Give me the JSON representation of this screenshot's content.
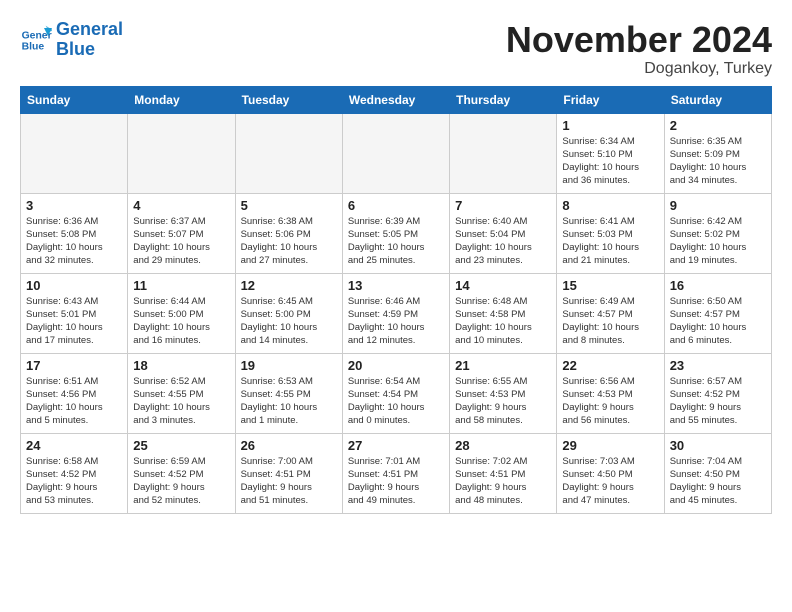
{
  "logo": {
    "line1": "General",
    "line2": "Blue"
  },
  "title": "November 2024",
  "location": "Dogankoy, Turkey",
  "columns": [
    "Sunday",
    "Monday",
    "Tuesday",
    "Wednesday",
    "Thursday",
    "Friday",
    "Saturday"
  ],
  "weeks": [
    [
      {
        "day": "",
        "info": ""
      },
      {
        "day": "",
        "info": ""
      },
      {
        "day": "",
        "info": ""
      },
      {
        "day": "",
        "info": ""
      },
      {
        "day": "",
        "info": ""
      },
      {
        "day": "1",
        "info": "Sunrise: 6:34 AM\nSunset: 5:10 PM\nDaylight: 10 hours\nand 36 minutes."
      },
      {
        "day": "2",
        "info": "Sunrise: 6:35 AM\nSunset: 5:09 PM\nDaylight: 10 hours\nand 34 minutes."
      }
    ],
    [
      {
        "day": "3",
        "info": "Sunrise: 6:36 AM\nSunset: 5:08 PM\nDaylight: 10 hours\nand 32 minutes."
      },
      {
        "day": "4",
        "info": "Sunrise: 6:37 AM\nSunset: 5:07 PM\nDaylight: 10 hours\nand 29 minutes."
      },
      {
        "day": "5",
        "info": "Sunrise: 6:38 AM\nSunset: 5:06 PM\nDaylight: 10 hours\nand 27 minutes."
      },
      {
        "day": "6",
        "info": "Sunrise: 6:39 AM\nSunset: 5:05 PM\nDaylight: 10 hours\nand 25 minutes."
      },
      {
        "day": "7",
        "info": "Sunrise: 6:40 AM\nSunset: 5:04 PM\nDaylight: 10 hours\nand 23 minutes."
      },
      {
        "day": "8",
        "info": "Sunrise: 6:41 AM\nSunset: 5:03 PM\nDaylight: 10 hours\nand 21 minutes."
      },
      {
        "day": "9",
        "info": "Sunrise: 6:42 AM\nSunset: 5:02 PM\nDaylight: 10 hours\nand 19 minutes."
      }
    ],
    [
      {
        "day": "10",
        "info": "Sunrise: 6:43 AM\nSunset: 5:01 PM\nDaylight: 10 hours\nand 17 minutes."
      },
      {
        "day": "11",
        "info": "Sunrise: 6:44 AM\nSunset: 5:00 PM\nDaylight: 10 hours\nand 16 minutes."
      },
      {
        "day": "12",
        "info": "Sunrise: 6:45 AM\nSunset: 5:00 PM\nDaylight: 10 hours\nand 14 minutes."
      },
      {
        "day": "13",
        "info": "Sunrise: 6:46 AM\nSunset: 4:59 PM\nDaylight: 10 hours\nand 12 minutes."
      },
      {
        "day": "14",
        "info": "Sunrise: 6:48 AM\nSunset: 4:58 PM\nDaylight: 10 hours\nand 10 minutes."
      },
      {
        "day": "15",
        "info": "Sunrise: 6:49 AM\nSunset: 4:57 PM\nDaylight: 10 hours\nand 8 minutes."
      },
      {
        "day": "16",
        "info": "Sunrise: 6:50 AM\nSunset: 4:57 PM\nDaylight: 10 hours\nand 6 minutes."
      }
    ],
    [
      {
        "day": "17",
        "info": "Sunrise: 6:51 AM\nSunset: 4:56 PM\nDaylight: 10 hours\nand 5 minutes."
      },
      {
        "day": "18",
        "info": "Sunrise: 6:52 AM\nSunset: 4:55 PM\nDaylight: 10 hours\nand 3 minutes."
      },
      {
        "day": "19",
        "info": "Sunrise: 6:53 AM\nSunset: 4:55 PM\nDaylight: 10 hours\nand 1 minute."
      },
      {
        "day": "20",
        "info": "Sunrise: 6:54 AM\nSunset: 4:54 PM\nDaylight: 10 hours\nand 0 minutes."
      },
      {
        "day": "21",
        "info": "Sunrise: 6:55 AM\nSunset: 4:53 PM\nDaylight: 9 hours\nand 58 minutes."
      },
      {
        "day": "22",
        "info": "Sunrise: 6:56 AM\nSunset: 4:53 PM\nDaylight: 9 hours\nand 56 minutes."
      },
      {
        "day": "23",
        "info": "Sunrise: 6:57 AM\nSunset: 4:52 PM\nDaylight: 9 hours\nand 55 minutes."
      }
    ],
    [
      {
        "day": "24",
        "info": "Sunrise: 6:58 AM\nSunset: 4:52 PM\nDaylight: 9 hours\nand 53 minutes."
      },
      {
        "day": "25",
        "info": "Sunrise: 6:59 AM\nSunset: 4:52 PM\nDaylight: 9 hours\nand 52 minutes."
      },
      {
        "day": "26",
        "info": "Sunrise: 7:00 AM\nSunset: 4:51 PM\nDaylight: 9 hours\nand 51 minutes."
      },
      {
        "day": "27",
        "info": "Sunrise: 7:01 AM\nSunset: 4:51 PM\nDaylight: 9 hours\nand 49 minutes."
      },
      {
        "day": "28",
        "info": "Sunrise: 7:02 AM\nSunset: 4:51 PM\nDaylight: 9 hours\nand 48 minutes."
      },
      {
        "day": "29",
        "info": "Sunrise: 7:03 AM\nSunset: 4:50 PM\nDaylight: 9 hours\nand 47 minutes."
      },
      {
        "day": "30",
        "info": "Sunrise: 7:04 AM\nSunset: 4:50 PM\nDaylight: 9 hours\nand 45 minutes."
      }
    ]
  ]
}
